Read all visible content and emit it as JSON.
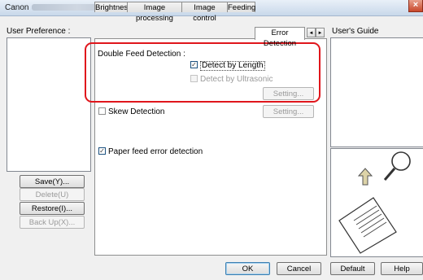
{
  "window": {
    "title_prefix": "Canon",
    "close_symbol": "×"
  },
  "left": {
    "user_preference_label": "User Preference :",
    "buttons": {
      "save": "Save(Y)...",
      "delete": "Delete(U)",
      "restore": "Restore(I)...",
      "backup": "Back Up(X)..."
    }
  },
  "tabs": [
    "Brightness",
    "Image processing",
    "Image control",
    "Feeding",
    "Error Detection"
  ],
  "tab_arrows": {
    "left": "◄",
    "right": "►"
  },
  "content": {
    "double_feed_label": "Double Feed Detection :",
    "detect_by_length": "Detect by Length",
    "detect_by_ultrasonic": "Detect by Ultrasonic",
    "setting1": "Setting...",
    "skew_detection": "Skew Detection",
    "setting2": "Setting...",
    "paper_feed_error": "Paper feed error detection"
  },
  "right": {
    "users_guide_label": "User's Guide"
  },
  "footer": {
    "ok": "OK",
    "cancel": "Cancel",
    "default": "Default",
    "help": "Help"
  },
  "checkboxes": {
    "detect_by_length": true,
    "detect_by_ultrasonic": false,
    "skew_detection": false,
    "paper_feed_error": true
  },
  "colors": {
    "highlight": "#e0161c",
    "accent": "#3c7fb1"
  }
}
